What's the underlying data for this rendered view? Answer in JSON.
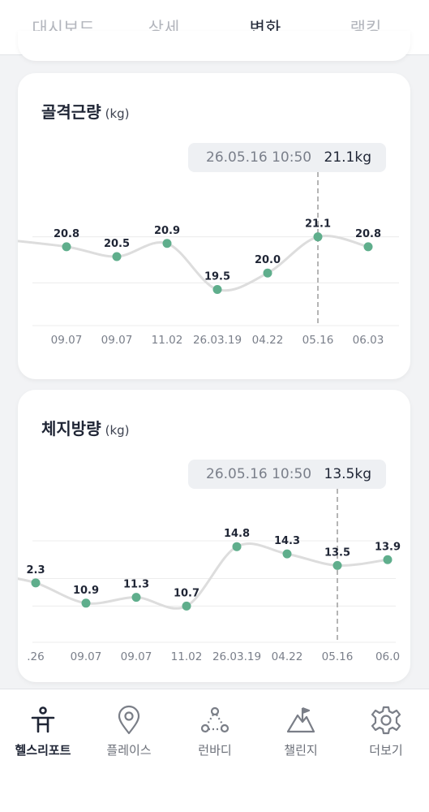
{
  "tabs": [
    {
      "label": "대시보드",
      "active": false
    },
    {
      "label": "상세",
      "active": false
    },
    {
      "label": "변화",
      "active": true
    },
    {
      "label": "랭킹",
      "active": false
    }
  ],
  "charts": [
    {
      "title": "골격근량",
      "unit": "(kg)",
      "tooltip": {
        "time": "26.05.16 10:50",
        "value": "21.1kg"
      },
      "chart_data": {
        "type": "line",
        "title": "골격근량",
        "ylabel": "(kg)",
        "categories": [
          "09.07",
          "09.07",
          "11.02",
          "26.03.19",
          "04.22",
          "05.16",
          "06.03"
        ],
        "values": [
          20.8,
          20.5,
          20.9,
          19.5,
          20.0,
          21.1,
          20.8
        ],
        "value_labels": [
          "20.8",
          "20.5",
          "20.9",
          "19.5",
          "20.0",
          "21.1",
          "20.8"
        ],
        "selected_index": 5,
        "ylim": [
          18.4,
          22.5
        ],
        "gridlines": [
          18.4,
          19.7,
          21.1
        ],
        "grid": true,
        "colors": {
          "point": "#5fae8c",
          "line": "#dddddd",
          "cursor": "#b5b5b5"
        }
      }
    },
    {
      "title": "체지방량",
      "unit": "(kg)",
      "tooltip": {
        "time": "26.05.16 10:50",
        "value": "13.5kg"
      },
      "chart_data": {
        "type": "line",
        "title": "체지방량",
        "ylabel": "(kg)",
        "categories": [
          ".26",
          "09.07",
          "09.07",
          "11.02",
          "26.03.19",
          "04.22",
          "05.16",
          "06.0"
        ],
        "values": [
          12.3,
          10.9,
          11.3,
          10.7,
          14.8,
          14.3,
          13.5,
          13.9
        ],
        "value_labels": [
          "2.3",
          "10.9",
          "11.3",
          "10.7",
          "14.8",
          "14.3",
          "13.5",
          "13.9"
        ],
        "selected_index": 6,
        "ylim": [
          8.2,
          17.5
        ],
        "gridlines": [
          8.2,
          10.7,
          12.6,
          15.2
        ],
        "grid": true,
        "colors": {
          "point": "#5fae8c",
          "line": "#dddddd",
          "cursor": "#b5b5b5"
        }
      }
    }
  ],
  "bottom_nav": [
    {
      "label": "헬스리포트",
      "icon": "health-report-icon",
      "active": true
    },
    {
      "label": "플레이스",
      "icon": "place-pin-icon",
      "active": false
    },
    {
      "label": "런바디",
      "icon": "runbody-icon",
      "active": false
    },
    {
      "label": "챌린지",
      "icon": "challenge-flag-icon",
      "active": false
    },
    {
      "label": "더보기",
      "icon": "gear-icon",
      "active": false
    }
  ]
}
